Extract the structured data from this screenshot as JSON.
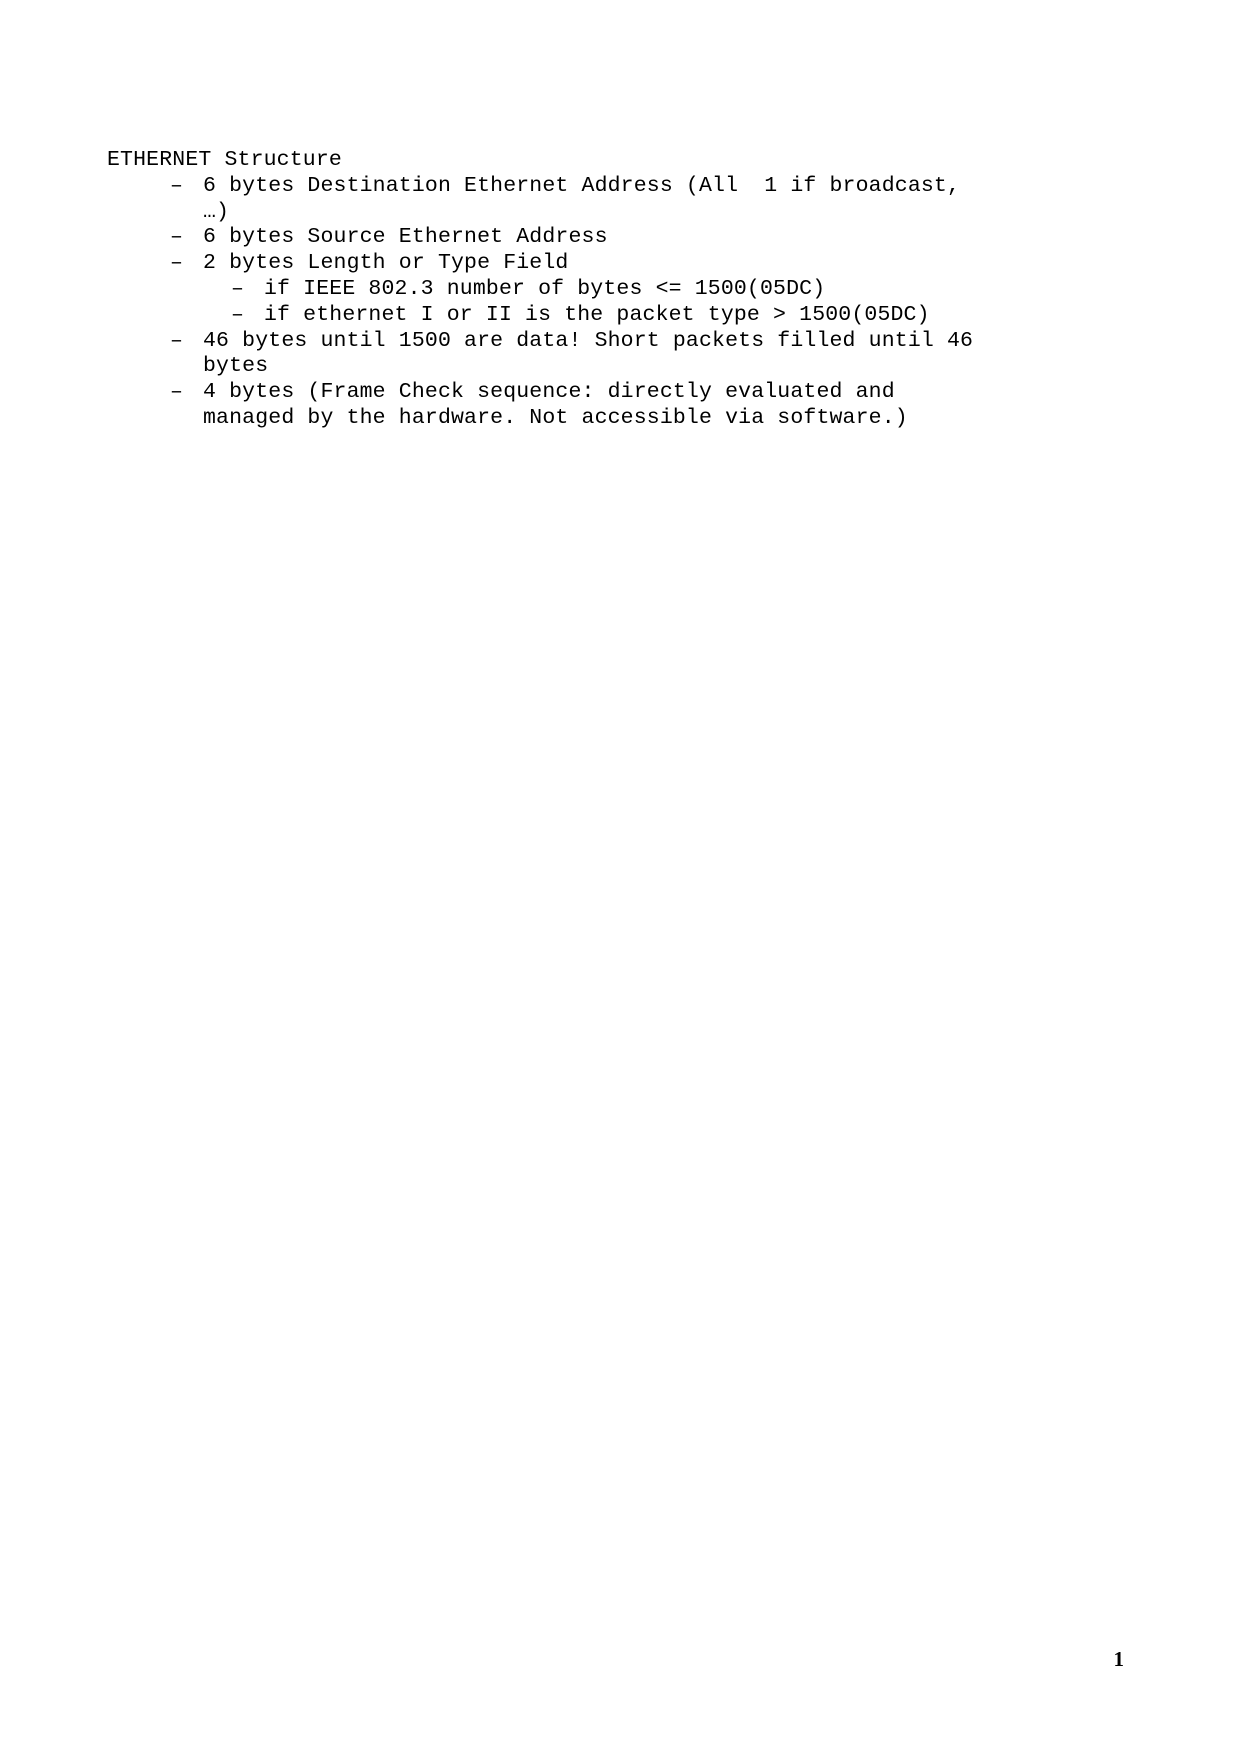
{
  "document": {
    "heading": "ETHERNET Structure",
    "bullet_marker": "–",
    "items": [
      {
        "id": "destination-address",
        "lines": [
          "6 bytes Destination Ethernet Address (All  1 if broadcast,",
          "…)"
        ],
        "children": []
      },
      {
        "id": "source-address",
        "lines": [
          "6 bytes Source Ethernet Address"
        ],
        "children": []
      },
      {
        "id": "length-or-type-field",
        "lines": [
          "2 bytes Length or Type Field"
        ],
        "children": [
          {
            "id": "ieee-802-3",
            "lines": [
              "if IEEE 802.3 number of bytes <= 1500(05DC)"
            ]
          },
          {
            "id": "ethernet-i-or-ii",
            "lines": [
              "if ethernet I or II is the packet type > 1500(05DC)"
            ]
          }
        ]
      },
      {
        "id": "data-field",
        "lines": [
          "46 bytes until 1500 are data! Short packets filled until 46",
          "bytes"
        ],
        "children": []
      },
      {
        "id": "frame-check-sequence",
        "lines": [
          "4 bytes (Frame Check sequence: directly evaluated and",
          "managed by the hardware. Not accessible via software.)"
        ],
        "children": []
      }
    ]
  },
  "footer": {
    "page_number": "1"
  }
}
